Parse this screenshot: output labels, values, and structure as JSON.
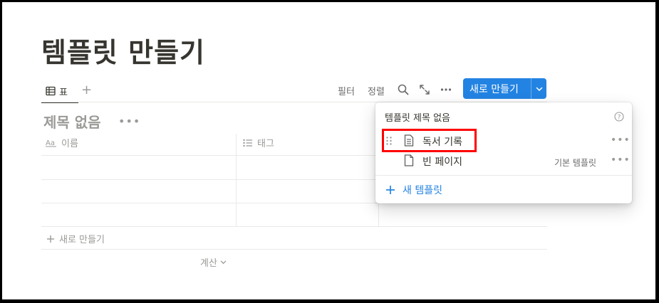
{
  "page": {
    "title": "템플릿 만들기"
  },
  "view_tabs": {
    "active_label": "표",
    "add_view_label": "+"
  },
  "toolbar": {
    "filter_label": "필터",
    "sort_label": "정렬",
    "new_button_label": "새로 만들기"
  },
  "database": {
    "title": "제목 없음",
    "more_label": "•••",
    "columns": [
      {
        "label": "이름",
        "icon": "text-property-icon"
      },
      {
        "label": "태그",
        "icon": "list-property-icon"
      }
    ],
    "new_row_label": "새로 만들기",
    "calc_label": "계산"
  },
  "template_menu": {
    "title": "템플릿 제목 없음",
    "templates": [
      {
        "label": "독서 기록",
        "badge": ""
      },
      {
        "label": "빈 페이지",
        "badge": "기본 템플릿"
      }
    ],
    "more_label": "•••",
    "new_template_label": "새 템플릿"
  },
  "colors": {
    "accent": "#2383e2",
    "highlight": "#ff0000",
    "text": "#37352f",
    "muted": "#9b9a97"
  }
}
